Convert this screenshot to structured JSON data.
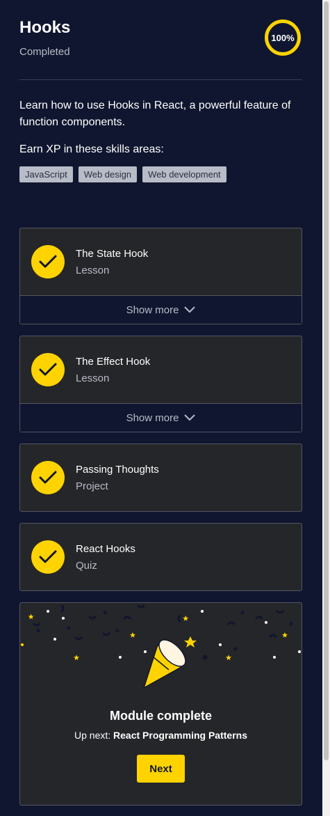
{
  "header": {
    "title": "Hooks",
    "status": "Completed",
    "progress": "100%"
  },
  "description": "Learn how to use Hooks in React, a powerful feature of function components.",
  "skills_heading": "Earn XP in these skills areas:",
  "skills": [
    "JavaScript",
    "Web design",
    "Web development"
  ],
  "items": [
    {
      "title": "The State Hook",
      "type": "Lesson",
      "show_more": "Show more"
    },
    {
      "title": "The Effect Hook",
      "type": "Lesson",
      "show_more": "Show more"
    },
    {
      "title": "Passing Thoughts",
      "type": "Project"
    },
    {
      "title": "React Hooks",
      "type": "Quiz"
    }
  ],
  "module_complete": {
    "title": "Module complete",
    "up_next_label": "Up next: ",
    "up_next_name": "React Programming Patterns",
    "next_button": "Next"
  },
  "colors": {
    "background": "#10162f",
    "card": "#252629",
    "accent": "#ffd300",
    "muted": "#b8bcc8"
  }
}
